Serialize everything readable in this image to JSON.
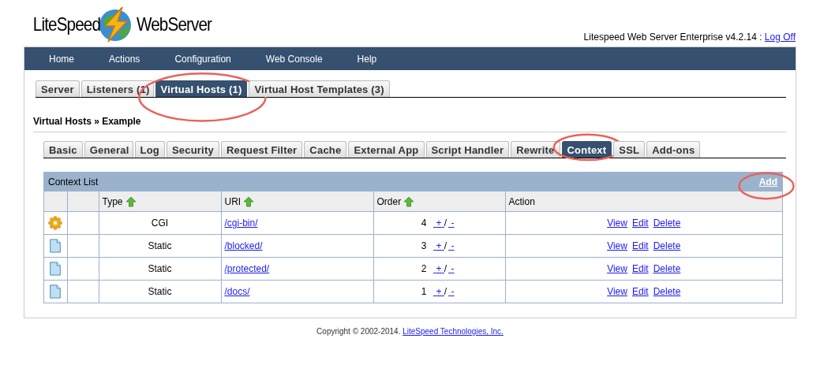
{
  "logo": {
    "left": "LiteSpeed",
    "right": "WebServer"
  },
  "version": {
    "text": "Litespeed Web Server Enterprise v4.2.14 :",
    "link": "Log Off"
  },
  "menu": [
    "Home",
    "Actions",
    "Configuration",
    "Web Console",
    "Help"
  ],
  "tabs": [
    {
      "label": "Server",
      "selected": false,
      "circled": false
    },
    {
      "label": "Listeners (1)",
      "selected": false,
      "circled": false
    },
    {
      "label": "Virtual Hosts (1)",
      "selected": true,
      "circled": true
    },
    {
      "label": "Virtual Host Templates (3)",
      "selected": false,
      "circled": false
    }
  ],
  "breadcrumb": "Virtual Hosts » Example",
  "subtabs": [
    {
      "label": "Basic",
      "selected": false,
      "circled": false
    },
    {
      "label": "General",
      "selected": false,
      "circled": false
    },
    {
      "label": "Log",
      "selected": false,
      "circled": false
    },
    {
      "label": "Security",
      "selected": false,
      "circled": false
    },
    {
      "label": "Request Filter",
      "selected": false,
      "circled": false
    },
    {
      "label": "Cache",
      "selected": false,
      "circled": false
    },
    {
      "label": "External App",
      "selected": false,
      "circled": false
    },
    {
      "label": "Script Handler",
      "selected": false,
      "circled": false
    },
    {
      "label": "Rewrite",
      "selected": false,
      "circled": false
    },
    {
      "label": "Context",
      "selected": true,
      "circled": true
    },
    {
      "label": "SSL",
      "selected": false,
      "circled": false
    },
    {
      "label": "Add-ons",
      "selected": false,
      "circled": false
    }
  ],
  "table": {
    "title": "Context List",
    "add": {
      "label": "Add",
      "circled": true
    },
    "columns": [
      {
        "label": "Type",
        "sortable": true
      },
      {
        "label": "URI",
        "sortable": true
      },
      {
        "label": "Order",
        "sortable": true
      },
      {
        "label": "Action",
        "sortable": false
      }
    ],
    "rows": [
      {
        "kind": "gear",
        "type": "CGI",
        "uri": "/cgi-bin/",
        "order": "4",
        "move": [
          "+",
          "/",
          "-"
        ],
        "actions": [
          "View",
          "Edit",
          "Delete"
        ]
      },
      {
        "kind": "file",
        "type": "Static",
        "uri": "/blocked/",
        "order": "3",
        "move": [
          "+",
          "/",
          "-"
        ],
        "actions": [
          "View",
          "Edit",
          "Delete"
        ]
      },
      {
        "kind": "file",
        "type": "Static",
        "uri": "/protected/",
        "order": "2",
        "move": [
          "+",
          "/",
          "-"
        ],
        "actions": [
          "View",
          "Edit",
          "Delete"
        ]
      },
      {
        "kind": "file",
        "type": "Static",
        "uri": "/docs/",
        "order": "1",
        "move": [
          "+",
          "/",
          "-"
        ],
        "actions": [
          "View",
          "Edit",
          "Delete"
        ]
      }
    ]
  },
  "footer": {
    "text": "Copyright © 2002-2014.",
    "link": "LiteSpeed Technologies, Inc."
  }
}
